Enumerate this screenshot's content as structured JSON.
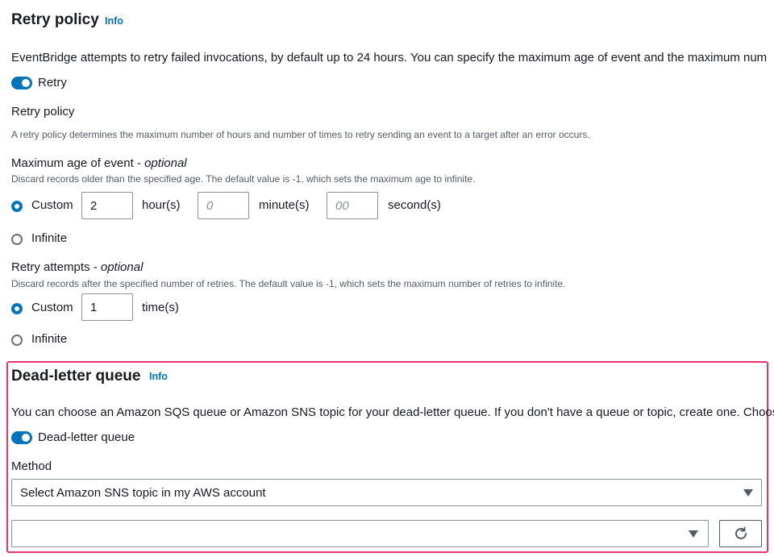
{
  "retry": {
    "heading": "Retry policy",
    "info_label": "Info",
    "description": "EventBridge attempts to retry failed invocations, by default up to 24 hours. You can specify the maximum age of event and the maximum num",
    "toggle_label": "Retry",
    "toggle_on": true,
    "policy_label": "Retry policy",
    "policy_description": "A retry policy determines the maximum number of hours and number of times to retry sending an event to a target after an error occurs.",
    "max_age": {
      "label": "Maximum age of event",
      "optional": "optional",
      "description": "Discard records older than the specified age. The default value is -1, which sets the maximum age to infinite.",
      "custom_label": "Custom",
      "infinite_label": "Infinite",
      "selected": "custom",
      "hours_value": "2",
      "hours_unit": "hour(s)",
      "minutes_placeholder": "0",
      "minutes_unit": "minute(s)",
      "seconds_placeholder": "00",
      "seconds_unit": "second(s)"
    },
    "attempts": {
      "label": "Retry attempts",
      "optional": "optional",
      "description": "Discard records after the specified number of retries. The default value is -1, which sets the maximum number of retries to infinite.",
      "custom_label": "Custom",
      "infinite_label": "Infinite",
      "selected": "custom",
      "times_value": "1",
      "times_unit": "time(s)"
    }
  },
  "dlq": {
    "heading": "Dead-letter queue",
    "info_label": "Info",
    "description": "You can choose an Amazon SQS queue or Amazon SNS topic for your dead-letter queue. If you don't have a queue or topic, create one. Choose",
    "toggle_label": "Dead-letter queue",
    "toggle_on": true,
    "method_label": "Method",
    "method_value": "Select Amazon SNS topic in my AWS account",
    "topic_value": ""
  },
  "icons": {
    "caret": "caret-down-icon",
    "refresh": "refresh-icon"
  },
  "colors": {
    "accent": "#0073bb",
    "highlight_border": "#e8336d",
    "text": "#16191f",
    "muted": "#545b64"
  }
}
